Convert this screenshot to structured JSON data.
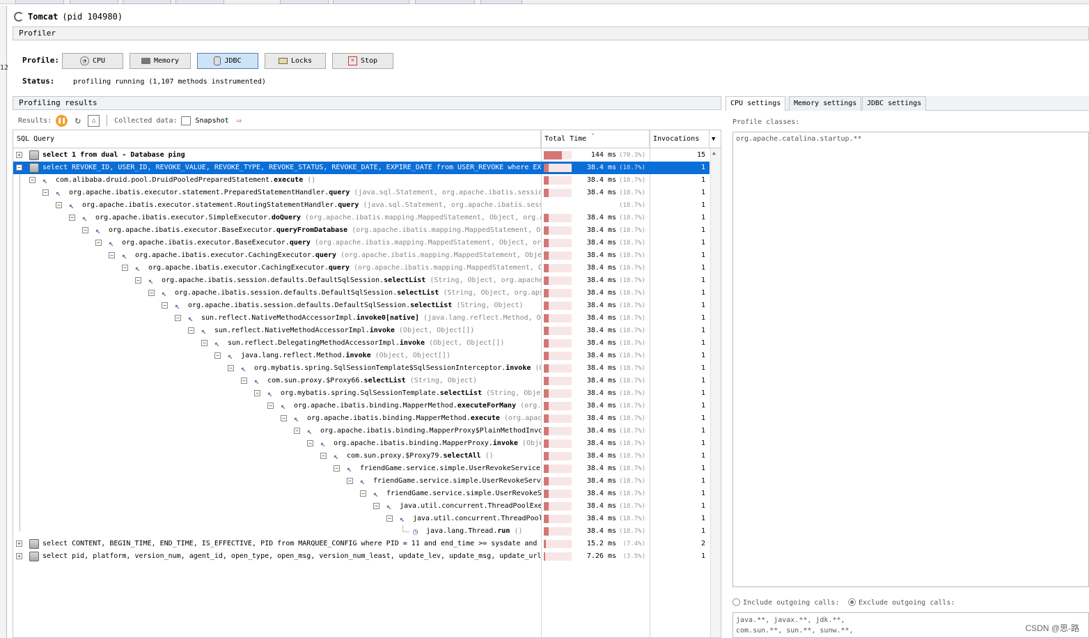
{
  "app": {
    "title": "Tomcat",
    "pid": "(pid 104980)"
  },
  "left_gutter_number": "12",
  "profiler": {
    "section_title": "Profiler",
    "profile_label": "Profile:",
    "buttons": [
      "CPU",
      "Memory",
      "JDBC",
      "Locks",
      "Stop"
    ],
    "active_button": "JDBC",
    "status_label": "Status:",
    "status_value": "profiling running (1,107 methods instrumented)"
  },
  "results": {
    "section_title": "Profiling results",
    "results_label": "Results:",
    "collected_label": "Collected data:",
    "snapshot_label": "Snapshot",
    "columns": {
      "query": "SQL Query",
      "time": "Total Time",
      "invocations": "Invocations"
    }
  },
  "rows": [
    {
      "kind": "db",
      "depth": 0,
      "toggle": "+",
      "name": "select 1 from dual - Database ping",
      "time": "144 ms",
      "pct": "(70.3%)",
      "frac": 0.703,
      "inv": "15",
      "bold": true
    },
    {
      "kind": "db",
      "depth": 0,
      "toggle": "-",
      "selected": true,
      "name": "select REVOKE_ID, USER_ID, REVOKE_VALUE, REVOKE_TYPE, REVOKE_STATUS, REVOKE_DATE, EXPIRE_DATE from USER_REVOKE where EXP",
      "time": "38.4 ms",
      "pct": "(18.7%)",
      "frac": 0.187,
      "inv": "1"
    },
    {
      "kind": "m",
      "depth": 1,
      "toggle": "-",
      "cls": "com.alibaba.druid.pool.DruidPooledPreparedStatement.",
      "meth": "execute",
      "sig": " ()",
      "time": "38.4 ms",
      "pct": "(18.7%)",
      "frac": 0.187,
      "inv": "1"
    },
    {
      "kind": "m",
      "depth": 2,
      "toggle": "-",
      "cls": "org.apache.ibatis.executor.statement.PreparedStatementHandler.",
      "meth": "query",
      "sig": " (java.sql.Statement, org.apache.ibatis.sessio",
      "time": "38.4 ms",
      "pct": "(18.7%)",
      "frac": 0.187,
      "inv": "1"
    },
    {
      "kind": "m",
      "depth": 3,
      "toggle": "-",
      "cls": "org.apache.ibatis.executor.statement.RoutingStatementHandler.",
      "meth": "query",
      "sig": " (java.sql.Statement, org.apache.ibatis.session.ResultHandler)",
      "time": "",
      "pct": "(18.7%)",
      "frac": 0,
      "inv": "1"
    },
    {
      "kind": "m",
      "depth": 4,
      "toggle": "-",
      "cls": "org.apache.ibatis.executor.SimpleExecutor.",
      "meth": "doQuery",
      "sig": " (org.apache.ibatis.mapping.MappedStatement, Object, org.a",
      "time": "38.4 ms",
      "pct": "(18.7%)",
      "frac": 0.187,
      "inv": "1"
    },
    {
      "kind": "m",
      "depth": 5,
      "toggle": "-",
      "cls": "org.apache.ibatis.executor.BaseExecutor.",
      "meth": "queryFromDatabase",
      "sig": " (org.apache.ibatis.mapping.MappedStatement, Ob",
      "time": "38.4 ms",
      "pct": "(18.7%)",
      "frac": 0.187,
      "inv": "1"
    },
    {
      "kind": "m",
      "depth": 6,
      "toggle": "-",
      "cls": "org.apache.ibatis.executor.BaseExecutor.",
      "meth": "query",
      "sig": " (org.apache.ibatis.mapping.MappedStatement, Object, or",
      "time": "38.4 ms",
      "pct": "(18.7%)",
      "frac": 0.187,
      "inv": "1"
    },
    {
      "kind": "m",
      "depth": 7,
      "toggle": "-",
      "cls": "org.apache.ibatis.executor.CachingExecutor.",
      "meth": "query",
      "sig": " (org.apache.ibatis.mapping.MappedStatement, Obje",
      "time": "38.4 ms",
      "pct": "(18.7%)",
      "frac": 0.187,
      "inv": "1"
    },
    {
      "kind": "m",
      "depth": 8,
      "toggle": "-",
      "cls": "org.apache.ibatis.executor.CachingExecutor.",
      "meth": "query",
      "sig": " (org.apache.ibatis.mapping.MappedStatement, O",
      "time": "38.4 ms",
      "pct": "(18.7%)",
      "frac": 0.187,
      "inv": "1"
    },
    {
      "kind": "m",
      "depth": 9,
      "toggle": "-",
      "cls": "org.apache.ibatis.session.defaults.DefaultSqlSession.",
      "meth": "selectList",
      "sig": " (String, Object, org.apache",
      "time": "38.4 ms",
      "pct": "(18.7%)",
      "frac": 0.187,
      "inv": "1"
    },
    {
      "kind": "m",
      "depth": 10,
      "toggle": "-",
      "cls": "org.apache.ibatis.session.defaults.DefaultSqlSession.",
      "meth": "selectList",
      "sig": " (String, Object, org.aps",
      "time": "38.4 ms",
      "pct": "(18.7%)",
      "frac": 0.187,
      "inv": "1"
    },
    {
      "kind": "m",
      "depth": 11,
      "toggle": "-",
      "cls": "org.apache.ibatis.session.defaults.DefaultSqlSession.",
      "meth": "selectList",
      "sig": " (String, Object)",
      "time": "38.4 ms",
      "pct": "(18.7%)",
      "frac": 0.187,
      "inv": "1"
    },
    {
      "kind": "m",
      "depth": 12,
      "toggle": "-",
      "cls": "sun.reflect.NativeMethodAccessorImpl.",
      "meth": "invoke0[native]",
      "sig": " (java.lang.reflect.Method, Ob",
      "time": "38.4 ms",
      "pct": "(18.7%)",
      "frac": 0.187,
      "inv": "1"
    },
    {
      "kind": "m",
      "depth": 13,
      "toggle": "-",
      "cls": "sun.reflect.NativeMethodAccessorImpl.",
      "meth": "invoke",
      "sig": " (Object, Object[])",
      "time": "38.4 ms",
      "pct": "(18.7%)",
      "frac": 0.187,
      "inv": "1"
    },
    {
      "kind": "m",
      "depth": 14,
      "toggle": "-",
      "cls": "sun.reflect.DelegatingMethodAccessorImpl.",
      "meth": "invoke",
      "sig": " (Object, Object[])",
      "time": "38.4 ms",
      "pct": "(18.7%)",
      "frac": 0.187,
      "inv": "1"
    },
    {
      "kind": "m",
      "depth": 15,
      "toggle": "-",
      "cls": "java.lang.reflect.Method.",
      "meth": "invoke",
      "sig": " (Object, Object[])",
      "time": "38.4 ms",
      "pct": "(18.7%)",
      "frac": 0.187,
      "inv": "1"
    },
    {
      "kind": "m",
      "depth": 16,
      "toggle": "-",
      "cls": "org.mybatis.spring.SqlSessionTemplate$SqlSessionInterceptor.",
      "meth": "invoke",
      "sig": " (O",
      "time": "38.4 ms",
      "pct": "(18.7%)",
      "frac": 0.187,
      "inv": "1"
    },
    {
      "kind": "m",
      "depth": 17,
      "toggle": "-",
      "cls": "com.sun.proxy.$Proxy66.",
      "meth": "selectList",
      "sig": " (String, Object)",
      "time": "38.4 ms",
      "pct": "(18.7%)",
      "frac": 0.187,
      "inv": "1"
    },
    {
      "kind": "m",
      "depth": 18,
      "toggle": "-",
      "cls": "org.mybatis.spring.SqlSessionTemplate.",
      "meth": "selectList",
      "sig": " (String, Obje",
      "time": "38.4 ms",
      "pct": "(18.7%)",
      "frac": 0.187,
      "inv": "1"
    },
    {
      "kind": "m",
      "depth": 19,
      "toggle": "-",
      "cls": "org.apache.ibatis.binding.MapperMethod.",
      "meth": "executeForMany",
      "sig": " (org.",
      "time": "38.4 ms",
      "pct": "(18.7%)",
      "frac": 0.187,
      "inv": "1"
    },
    {
      "kind": "m",
      "depth": 20,
      "toggle": "-",
      "cls": "org.apache.ibatis.binding.MapperMethod.",
      "meth": "execute",
      "sig": " (org.apac",
      "time": "38.4 ms",
      "pct": "(18.7%)",
      "frac": 0.187,
      "inv": "1"
    },
    {
      "kind": "m",
      "depth": 21,
      "toggle": "-",
      "cls": "org.apache.ibatis.binding.MapperProxy$PlainMethodInvo",
      "meth": "",
      "sig": "",
      "time": "38.4 ms",
      "pct": "(18.7%)",
      "frac": 0.187,
      "inv": "1"
    },
    {
      "kind": "m",
      "depth": 22,
      "toggle": "-",
      "cls": "org.apache.ibatis.binding.MapperProxy.",
      "meth": "invoke",
      "sig": " (Obje",
      "time": "38.4 ms",
      "pct": "(18.7%)",
      "frac": 0.187,
      "inv": "1"
    },
    {
      "kind": "m",
      "depth": 23,
      "toggle": "-",
      "cls": "com.sun.proxy.$Proxy79.",
      "meth": "selectAll",
      "sig": " ()",
      "time": "38.4 ms",
      "pct": "(18.7%)",
      "frac": 0.187,
      "inv": "1"
    },
    {
      "kind": "m",
      "depth": 24,
      "toggle": "-",
      "cls": "friendGame.service.simple.UserRevokeService.",
      "meth": "",
      "sig": "",
      "time": "38.4 ms",
      "pct": "(18.7%)",
      "frac": 0.187,
      "inv": "1"
    },
    {
      "kind": "m",
      "depth": 25,
      "toggle": "-",
      "cls": "friendGame.service.simple.UserRevokeServ",
      "meth": "",
      "sig": "",
      "time": "38.4 ms",
      "pct": "(18.7%)",
      "frac": 0.187,
      "inv": "1"
    },
    {
      "kind": "m",
      "depth": 26,
      "toggle": "-",
      "cls": "friendGame.service.simple.UserRevokeS",
      "meth": "",
      "sig": "",
      "time": "38.4 ms",
      "pct": "(18.7%)",
      "frac": 0.187,
      "inv": "1"
    },
    {
      "kind": "m",
      "depth": 27,
      "toggle": "-",
      "cls": "java.util.concurrent.ThreadPoolExe",
      "meth": "",
      "sig": "",
      "time": "38.4 ms",
      "pct": "(18.7%)",
      "frac": 0.187,
      "inv": "1"
    },
    {
      "kind": "m",
      "depth": 28,
      "toggle": "-",
      "cls": "java.util.concurrent.ThreadPool",
      "meth": "",
      "sig": "",
      "time": "38.4 ms",
      "pct": "(18.7%)",
      "frac": 0.187,
      "inv": "1"
    },
    {
      "kind": "t",
      "depth": 29,
      "toggle": "",
      "cls": "java.lang.Thread.",
      "meth": "run",
      "sig": " ()",
      "time": "38.4 ms",
      "pct": "(18.7%)",
      "frac": 0.187,
      "inv": "1"
    },
    {
      "kind": "db",
      "depth": 0,
      "toggle": "+",
      "name": "select CONTENT, BEGIN_TIME, END_TIME, IS_EFFECTIVE, PID from MARQUEE_CONFIG where PID = 11 and end_time >= sysdate and s",
      "time": "15.2 ms",
      "pct": "(7.4%)",
      "frac": 0.074,
      "inv": "2"
    },
    {
      "kind": "db",
      "depth": 0,
      "toggle": "+",
      "name": "select pid, platform, version_num, agent_id, open_type, open_msg, version_num_least, update_lev, update_msg, update_url",
      "time": "7.26 ms",
      "pct": "(3.5%)",
      "frac": 0.035,
      "inv": "1"
    }
  ],
  "settings": {
    "tabs": [
      "CPU settings",
      "Memory settings",
      "JDBC settings"
    ],
    "active_tab": "CPU settings",
    "profile_classes_label": "Profile classes:",
    "profile_classes_value": "org.apache.catalina.startup.**",
    "include_label": "Include outgoing calls:",
    "exclude_label": "Exclude outgoing calls:",
    "exclude_selected": true,
    "exclude_value_line1": "java.**, javax.**, jdk.**,",
    "exclude_value_line2": "com.sun.**, sun.**, sunw.**,"
  },
  "watermark": "CSDN @思-路",
  "colors": {
    "selection": "#0a6ed6",
    "bar_fill": "#d47676",
    "bar_bg": "#f8e6e6",
    "active_button": "#cfe3f6"
  }
}
